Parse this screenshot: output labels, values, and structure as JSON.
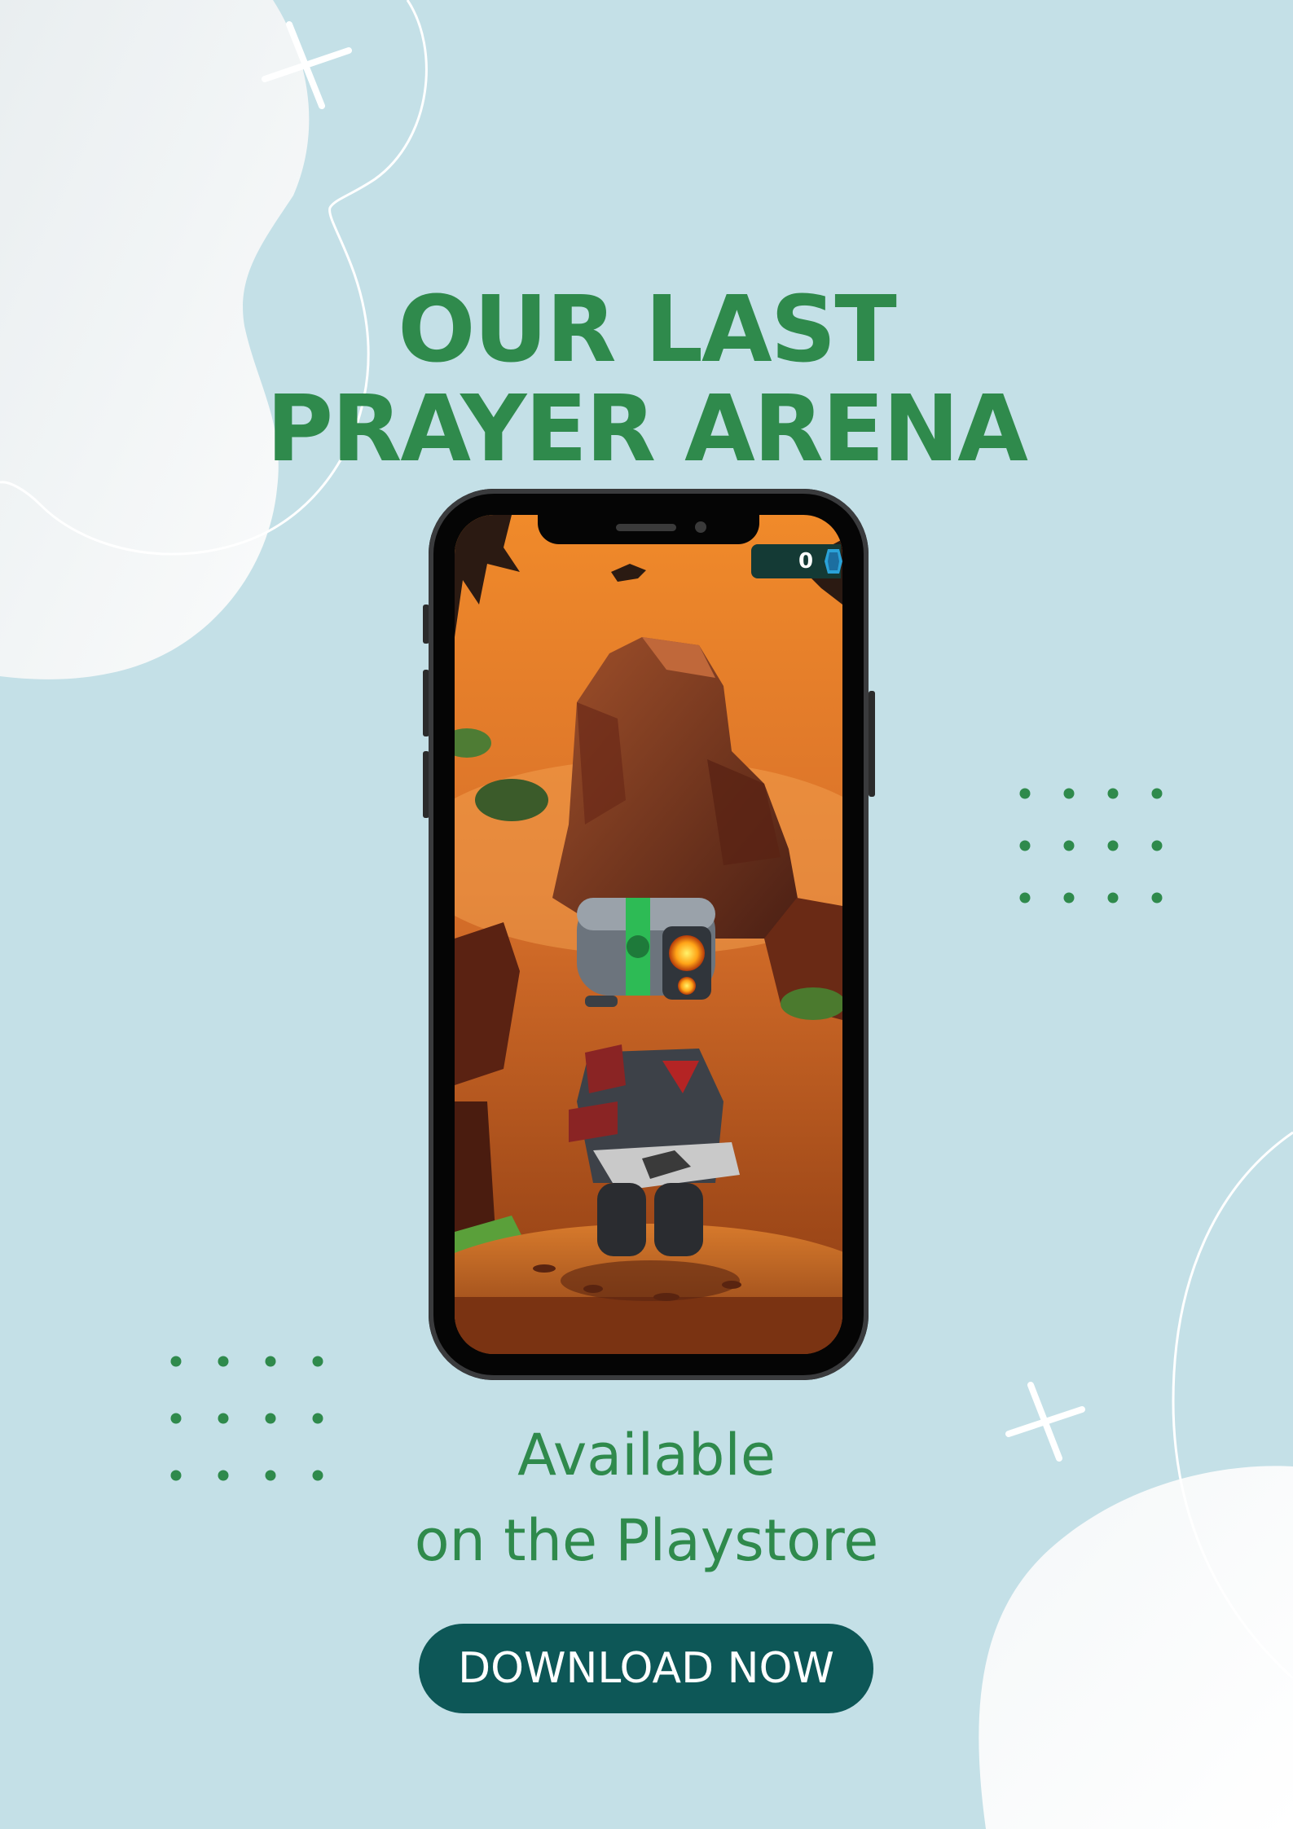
{
  "poster": {
    "title_line1": "OUR LAST",
    "title_line2": "PRAYER ARENA",
    "subtitle_line1": "Available",
    "subtitle_line2": "on the Playstore",
    "cta_label": "DOWNLOAD NOW"
  },
  "game_screen": {
    "score": "0"
  },
  "colors": {
    "background": "#c4e0e7",
    "title_green": "#2f8a4c",
    "button_teal": "#0d5757",
    "button_text": "#ffffff"
  },
  "icons": [
    "plus-sparkle-icon",
    "dot-grid",
    "gem-icon",
    "speaker-icon",
    "camera-icon"
  ]
}
